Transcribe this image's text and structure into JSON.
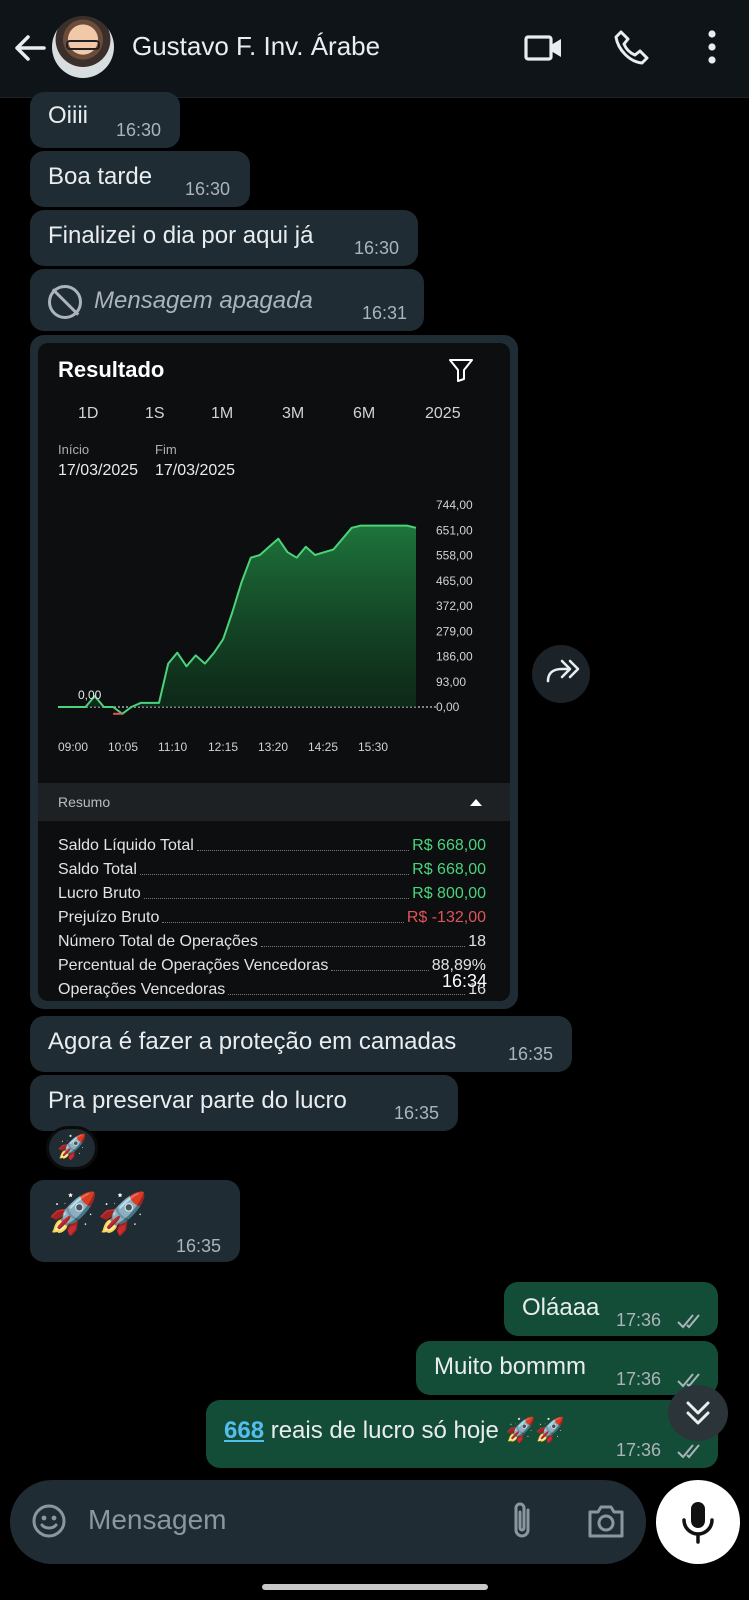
{
  "header": {
    "contact_name": "Gustavo F. Inv. Árabe",
    "icons": [
      "back-arrow-icon",
      "video-call-icon",
      "phone-icon",
      "more-vert-icon"
    ]
  },
  "messages": [
    {
      "text": "Oiiii",
      "time": "16:30"
    },
    {
      "text": "Boa tarde",
      "time": "16:30"
    },
    {
      "text": "Finalizei o dia por aqui já",
      "time": "16:30"
    },
    {
      "text": "Mensagem apagada",
      "time": "16:31"
    },
    {
      "text": "Agora é fazer a proteção em camadas",
      "time": "16:35"
    },
    {
      "text": "Pra preservar parte do lucro",
      "time": "16:35"
    },
    {
      "text": "🚀🚀",
      "time": "16:35"
    },
    {
      "text": "Oláaaa",
      "time": "17:36"
    },
    {
      "text": "Muito bommm",
      "time": "17:36"
    },
    {
      "link": "668",
      "text": " reais de lucro só hoje 🚀🚀",
      "time": "17:36"
    }
  ],
  "reaction": "🚀",
  "image": {
    "time": "16:34",
    "title": "Resultado",
    "periods": [
      "1D",
      "1S",
      "1M",
      "3M",
      "6M",
      "2025"
    ],
    "start_label": "Início",
    "start_date": "17/03/2025",
    "end_label": "Fim",
    "end_date": "17/03/2025",
    "chart_data": {
      "type": "area",
      "title": "",
      "x": [
        "09:00",
        "10:05",
        "11:10",
        "12:15",
        "13:20",
        "14:25",
        "15:30"
      ],
      "y_ticks": [
        "744,00",
        "651,00",
        "558,00",
        "465,00",
        "372,00",
        "279,00",
        "186,00",
        "93,00",
        "0,00"
      ],
      "ylim": [
        0,
        744
      ],
      "baseline_label": "0,00",
      "series": [
        {
          "values": [
            0,
            0,
            0,
            0,
            40,
            0,
            0,
            -25,
            0,
            15,
            15,
            15,
            160,
            200,
            150,
            190,
            160,
            200,
            250,
            350,
            460,
            550,
            560,
            590,
            620,
            570,
            550,
            590,
            560,
            570,
            580,
            620,
            660,
            668,
            668,
            668,
            668,
            668,
            668,
            660
          ],
          "color": "#4bd37b"
        }
      ],
      "grid": false
    },
    "summary_title": "Resumo",
    "summary": [
      {
        "label": "Saldo Líquido Total",
        "value": "R$ 668,00",
        "tone": "green"
      },
      {
        "label": "Saldo Total",
        "value": "R$ 668,00",
        "tone": "green"
      },
      {
        "label": "Lucro Bruto",
        "value": "R$ 800,00",
        "tone": "green"
      },
      {
        "label": "Prejuízo Bruto",
        "value": "R$ -132,00",
        "tone": "red"
      },
      {
        "label": "Número Total de Operações",
        "value": "18",
        "tone": "plain"
      },
      {
        "label": "Percentual de Operações Vencedoras",
        "value": "88,89%",
        "tone": "plain"
      },
      {
        "label": "Operações Vencedoras",
        "value": "16",
        "tone": "plain"
      }
    ]
  },
  "input": {
    "placeholder": "Mensagem"
  }
}
